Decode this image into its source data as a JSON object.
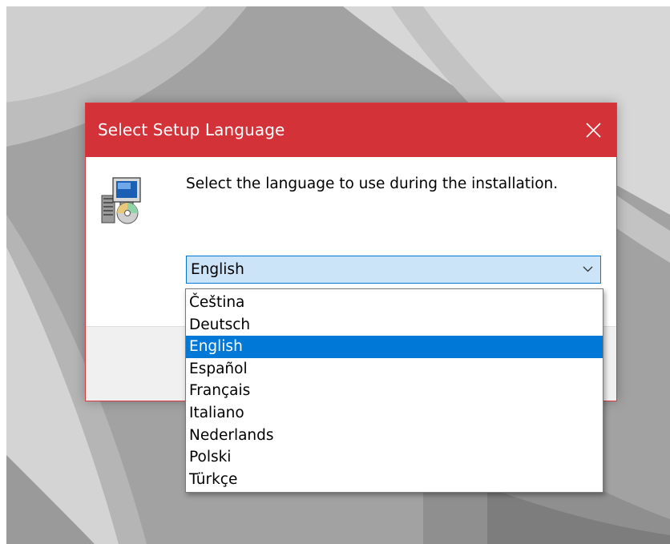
{
  "dialog": {
    "title": "Select Setup Language",
    "close_icon": "close-icon",
    "setup_icon": "setup-installer-icon",
    "prompt": "Select the language to use during the installation."
  },
  "language_select": {
    "selected": "English",
    "arrow_icon": "chevron-down-icon",
    "options": [
      "Čeština",
      "Deutsch",
      "English",
      "Español",
      "Français",
      "Italiano",
      "Nederlands",
      "Polski",
      "Türkçe"
    ],
    "highlighted_index": 2
  },
  "colors": {
    "titlebar": "#d23238",
    "selection": "#0078d7",
    "combo_background": "#cce4f7",
    "dialog_background": "#f0f0f0"
  }
}
